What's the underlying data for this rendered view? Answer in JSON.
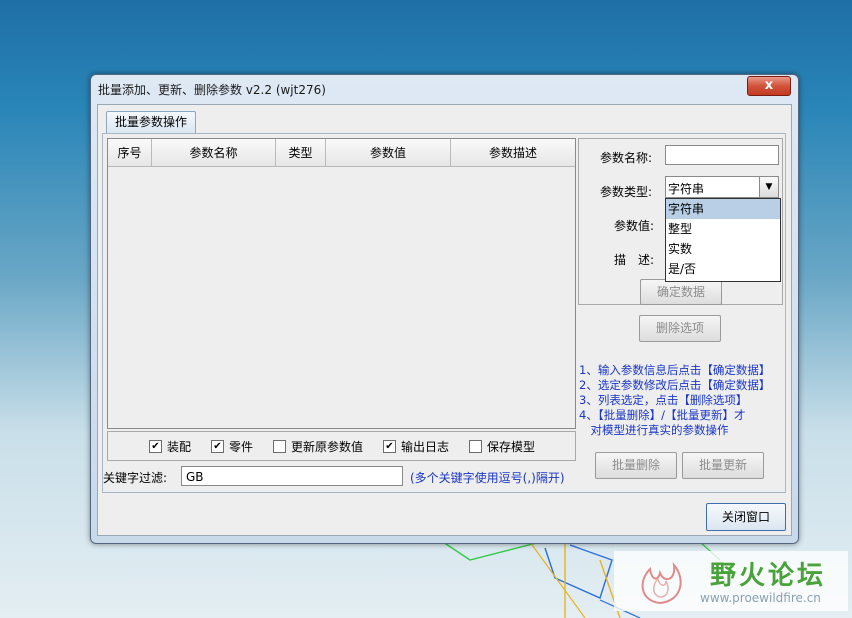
{
  "window": {
    "title": "批量添加、更新、删除参数 v2.2 (wjt276)",
    "close_glyph": "x"
  },
  "tabs": [
    {
      "label": "批量参数操作"
    }
  ],
  "table": {
    "columns": [
      "序号",
      "参数名称",
      "类型",
      "参数值",
      "参数描述"
    ],
    "rows": []
  },
  "options": {
    "checkboxes": [
      {
        "label": "装配",
        "checked": true
      },
      {
        "label": "零件",
        "checked": true
      },
      {
        "label": "更新原参数值",
        "checked": false
      },
      {
        "label": "输出日志",
        "checked": true
      },
      {
        "label": "保存模型",
        "checked": false
      }
    ]
  },
  "filter": {
    "label": "关键字过滤:",
    "value": "GB",
    "hint": "(多个关键字使用逗号(,)隔开)"
  },
  "form": {
    "name_label": "参数名称:",
    "name_value": "",
    "type_label": "参数类型:",
    "type_value": "字符串",
    "type_options": [
      "字符串",
      "整型",
      "实数",
      "是/否"
    ],
    "value_label": "参数值:",
    "desc_label": "描　述:",
    "confirm_button": "确定数据",
    "delete_option_button": "删除选项"
  },
  "help": [
    "1、输入参数信息后点击【确定数据】",
    "2、选定参数修改后点击【确定数据】",
    "3、列表选定，点击【删除选项】",
    "4、【批量删除】/【批量更新】才",
    "　对模型进行真实的参数操作"
  ],
  "actions": {
    "batch_delete": "批量删除",
    "batch_update": "批量更新",
    "close_window": "关闭窗口"
  },
  "watermark": {
    "name": "野火论坛",
    "url": "www.proewildfire.cn"
  },
  "colors": {
    "hint_blue": "#1a36c8",
    "selection": "#b8cfe5",
    "watermark_green": "#4aa23a"
  }
}
